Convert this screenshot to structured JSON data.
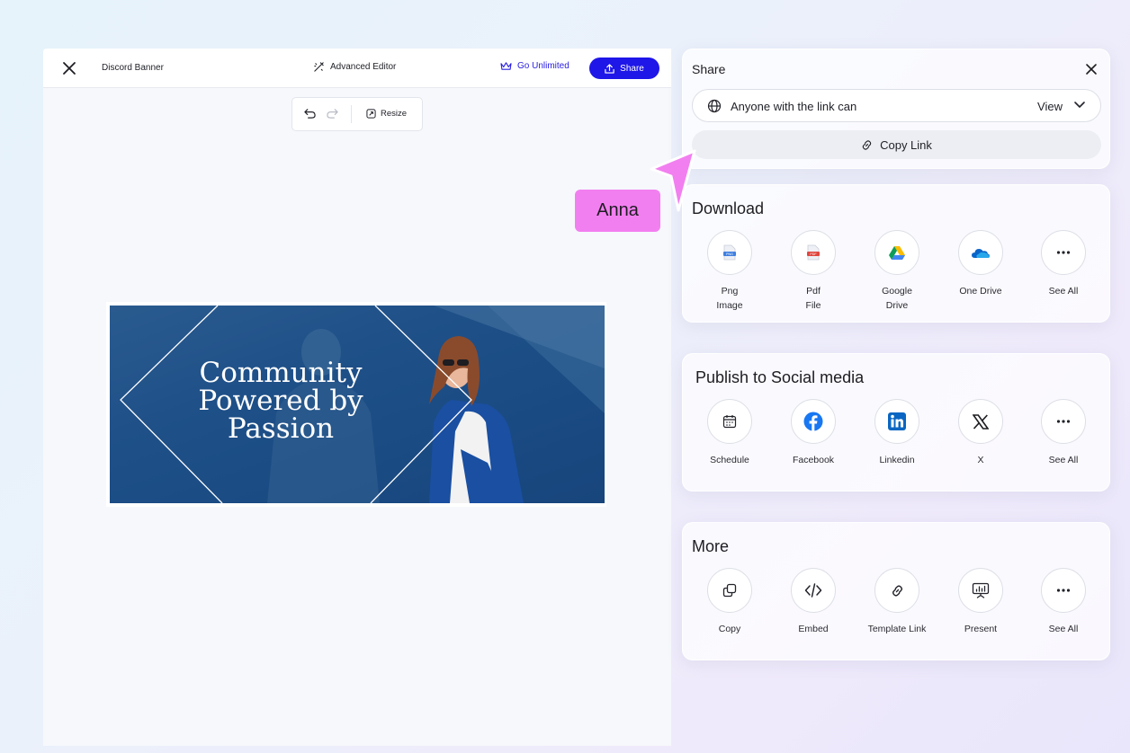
{
  "editor": {
    "doc_title": "Discord Banner",
    "advanced_editor": "Advanced Editor",
    "go_unlimited": "Go Unlimited",
    "share": "Share",
    "resize": "Resize"
  },
  "banner": {
    "title_line1": "Community",
    "title_line2": "Powered by",
    "title_line3": "Passion"
  },
  "share_panel": {
    "title": "Share",
    "access_label": "Anyone with the link can",
    "access_value": "View",
    "copy_link": "Copy Link"
  },
  "download": {
    "title": "Download",
    "items": [
      {
        "label": "Png\nImage",
        "icon": "png-file-icon"
      },
      {
        "label": "Pdf\nFile",
        "icon": "pdf-file-icon"
      },
      {
        "label": "Google\nDrive",
        "icon": "google-drive-icon"
      },
      {
        "label": "One Drive",
        "icon": "onedrive-icon"
      },
      {
        "label": "See All",
        "icon": "more-dots-icon"
      }
    ]
  },
  "social": {
    "title": "Publish to Social media",
    "items": [
      {
        "label": "Schedule",
        "icon": "calendar-icon"
      },
      {
        "label": "Facebook",
        "icon": "facebook-icon"
      },
      {
        "label": "Linkedin",
        "icon": "linkedin-icon"
      },
      {
        "label": "X",
        "icon": "x-logo-icon"
      },
      {
        "label": "See All",
        "icon": "more-dots-icon"
      }
    ]
  },
  "more": {
    "title": "More",
    "items": [
      {
        "label": "Copy",
        "icon": "copy-icon"
      },
      {
        "label": "Embed",
        "icon": "code-icon"
      },
      {
        "label": "Template Link",
        "icon": "link-icon"
      },
      {
        "label": "Present",
        "icon": "presentation-icon"
      },
      {
        "label": "See All",
        "icon": "more-dots-icon"
      }
    ]
  },
  "collaborator": {
    "name": "Anna",
    "color": "#f27ff0"
  },
  "colors": {
    "primary": "#1f16e8",
    "accent_link": "#2b21e0",
    "banner_blue": "#1f5088"
  }
}
